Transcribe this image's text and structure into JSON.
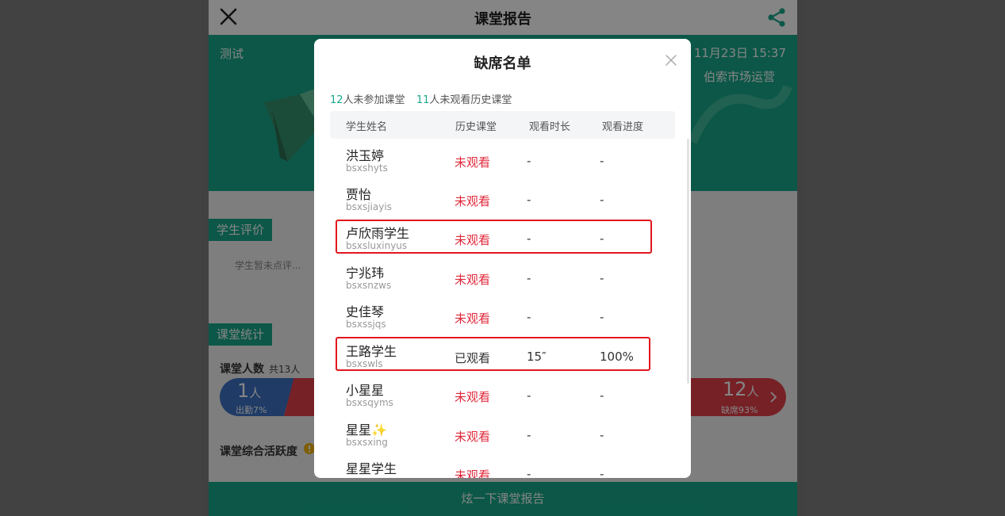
{
  "page": {
    "title": "课堂报告",
    "banner": {
      "name": "测试",
      "date": "11月23日 15:37",
      "shop": "伯索市场运营"
    },
    "student_eval": {
      "tag": "学生评价",
      "empty_text": "学生暂未点评..."
    },
    "class_stats": {
      "tag": "课堂统计",
      "count_label": "课堂人数",
      "count_total": "共13人",
      "present_num": "1",
      "present_unit": "人",
      "present_pct": "出勤7%",
      "absent_num": "12",
      "absent_unit": "人",
      "absent_pct": "缺席93%",
      "activity_label": "课堂综合活跃度"
    },
    "bottom_button": "炫一下课堂报告"
  },
  "modal": {
    "title": "缺席名单",
    "summary": {
      "not_attended_num": "12",
      "not_attended_text": "人未参加课堂",
      "not_watched_num": "11",
      "not_watched_text": "人未观看历史课堂"
    },
    "columns": [
      "学生姓名",
      "历史课堂",
      "观看时长",
      "观看进度"
    ],
    "rows": [
      {
        "name": "洪玉婷",
        "id": "bsxshyts",
        "history": "未观看",
        "duration": "-",
        "progress": "-"
      },
      {
        "name": "贾怡",
        "id": "bsxsjiayis",
        "history": "未观看",
        "duration": "-",
        "progress": "-"
      },
      {
        "name": "卢欣雨学生",
        "id": "bsxsluxinyus",
        "history": "未观看",
        "duration": "-",
        "progress": "-"
      },
      {
        "name": "宁兆玮",
        "id": "bsxsnzws",
        "history": "未观看",
        "duration": "-",
        "progress": "-"
      },
      {
        "name": "史佳琴",
        "id": "bsxssjqs",
        "history": "未观看",
        "duration": "-",
        "progress": "-"
      },
      {
        "name": "王路学生",
        "id": "bsxswls",
        "history": "已观看",
        "duration": "15″",
        "progress": "100%"
      },
      {
        "name": "小星星",
        "id": "bsxsqyms",
        "history": "未观看",
        "duration": "-",
        "progress": "-"
      },
      {
        "name": "星星✨",
        "id": "bsxsxing",
        "history": "未观看",
        "duration": "-",
        "progress": "-"
      },
      {
        "name": "星星学生",
        "id": "",
        "history": "未观看",
        "duration": "-",
        "progress": "-"
      }
    ]
  },
  "colors": {
    "accent": "#17a88b",
    "absent_red": "#e0283a",
    "highlight_box": "#e1161e",
    "present_blue": "#3c72c4"
  },
  "icons": [
    "close-icon",
    "share-icon",
    "chevron-right-icon",
    "info-icon"
  ]
}
